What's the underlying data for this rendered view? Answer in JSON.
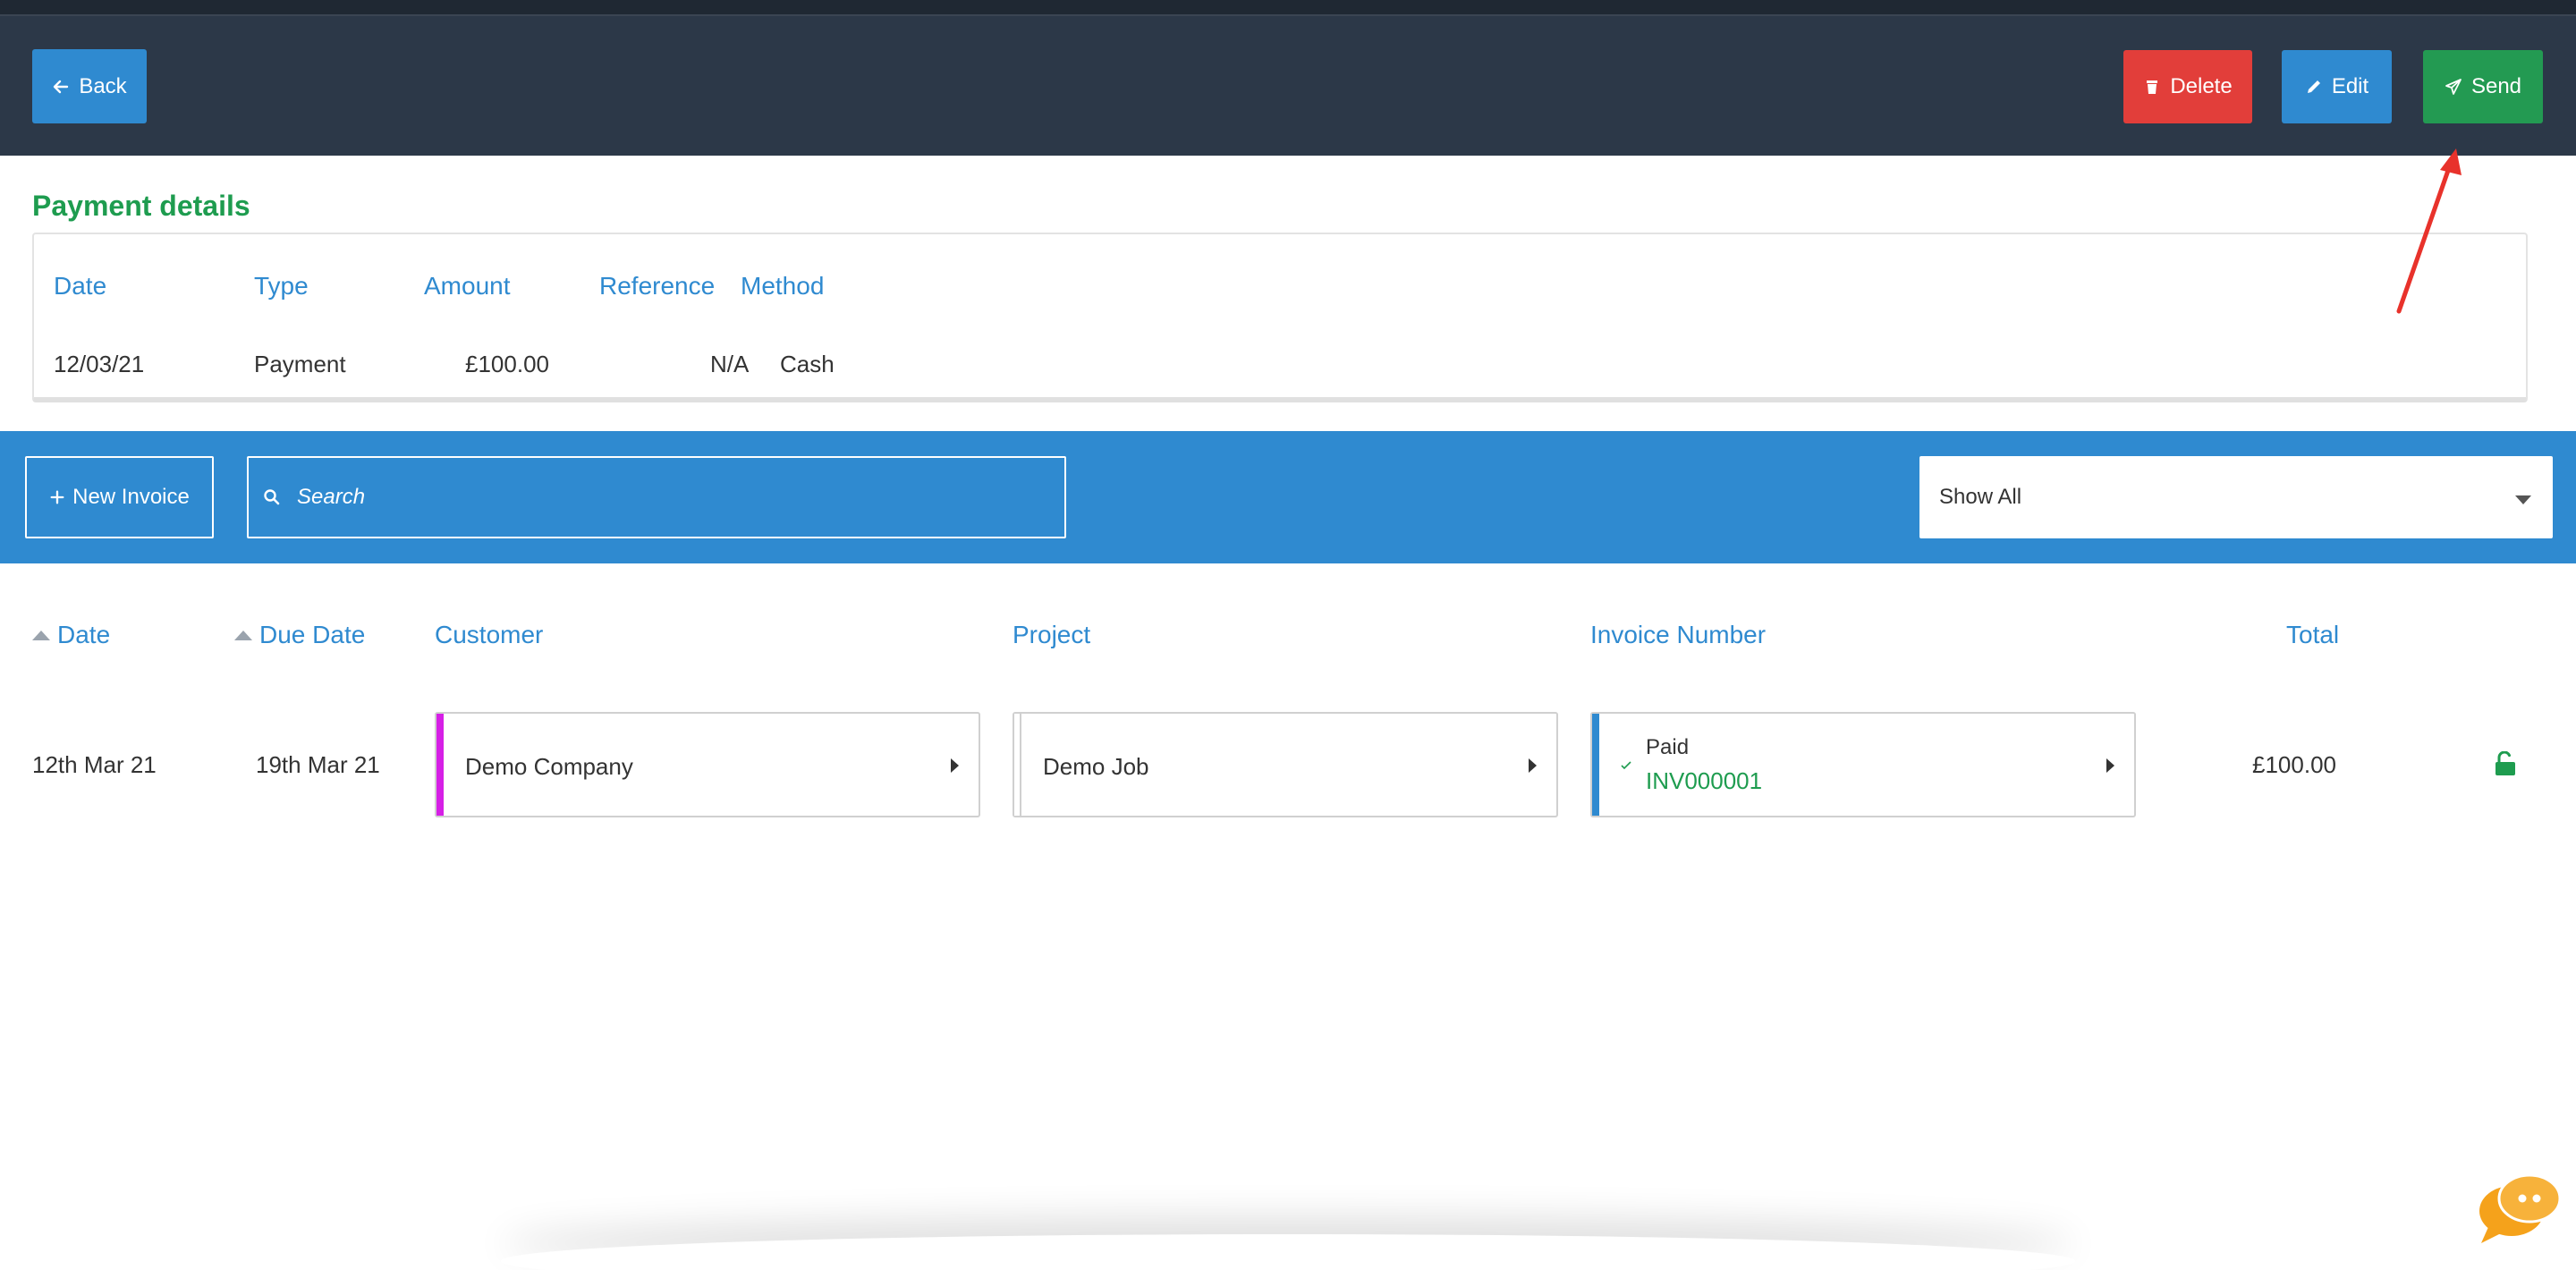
{
  "header": {
    "back_label": "Back",
    "delete_label": "Delete",
    "edit_label": "Edit",
    "send_label": "Send"
  },
  "payment_details": {
    "title": "Payment details",
    "columns": [
      "Date",
      "Type",
      "Amount",
      "Reference",
      "Method"
    ],
    "rows": [
      {
        "date": "12/03/21",
        "type": "Payment",
        "amount": "£100.00",
        "reference": "N/A",
        "method": "Cash"
      }
    ]
  },
  "toolbar": {
    "new_invoice_label": "New Invoice",
    "search_placeholder": "Search",
    "filter_selected": "Show All"
  },
  "invoices": {
    "columns": {
      "date": "Date",
      "due_date": "Due Date",
      "customer": "Customer",
      "project": "Project",
      "invoice_number": "Invoice Number",
      "total": "Total"
    },
    "rows": [
      {
        "date": "12th Mar 21",
        "due_date": "19th Mar 21",
        "customer": "Demo Company",
        "project": "Demo Job",
        "status": "Paid",
        "invoice_number": "INV000001",
        "total": "£100.00"
      }
    ]
  },
  "colors": {
    "header_bg": "#2c3848",
    "primary_blue": "#2f8ad0",
    "danger_red": "#e23e3a",
    "success_green": "#239a52",
    "customer_accent": "#d61fe6",
    "chat_orange": "#f5a21b"
  },
  "icons": [
    "arrow-left-icon",
    "trash-icon",
    "pencil-icon",
    "paper-plane-icon",
    "plus-icon",
    "search-icon",
    "caret-down-icon",
    "sort-up-icon",
    "chevron-right-icon",
    "check-icon",
    "unlock-icon",
    "chat-bubbles-icon"
  ]
}
